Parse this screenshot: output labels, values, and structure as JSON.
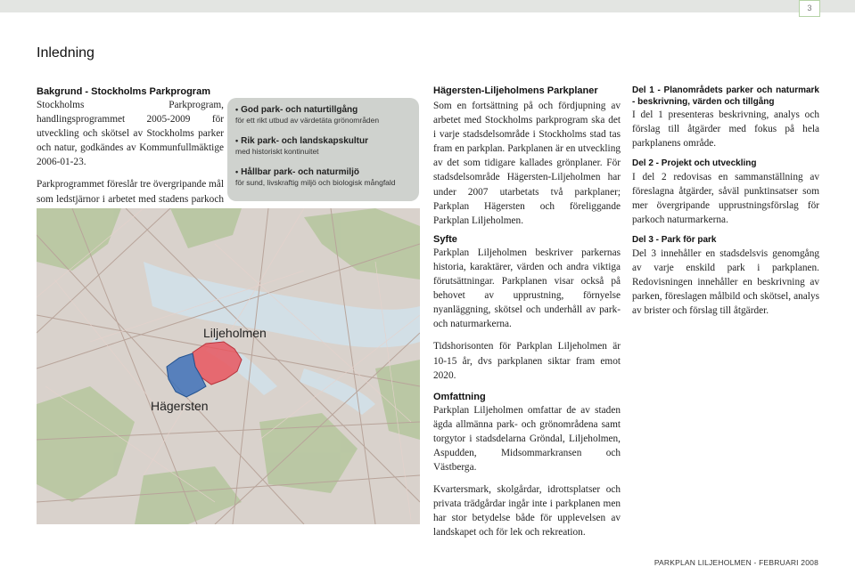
{
  "page_number": "3",
  "title": "Inledning",
  "col1": {
    "heading": "Bakgrund - Stockholms Parkprogram",
    "para1": "Stockholms Parkprogram, handlingsprogrammet 2005-2009 för utveckling och skötsel av Stockholms parker och natur, godkändes av Kommunfullmäktige 2006-01-23.",
    "para2": "Parkprogrammet föreslår tre övergripande mål som ledstjärnor i arbetet med stadens parkoch naturmark:"
  },
  "callout": {
    "items": [
      {
        "head": "God park- och naturtillgång",
        "sub1": "för ett rikt utbud av värdetäta grönområden",
        "sub2": ""
      },
      {
        "head": "Rik park- och landskapskultur",
        "sub1": "med historiskt kontinuitet",
        "sub2": ""
      },
      {
        "head": "Hållbar park- och naturmiljö",
        "sub1": "för sund, livskraftig miljö och biologisk mångfald",
        "sub2": ""
      }
    ]
  },
  "map": {
    "label_liljeholmen": "Liljeholmen",
    "label_hagersten": "Hägersten",
    "colors": {
      "liljeholmen": "#e8575f",
      "hagersten": "#3f72b8",
      "base": "#d7a8a8"
    }
  },
  "col2": {
    "heading": "Hägersten-Liljeholmens Parkplaner",
    "para1": "Som en fortsättning på och fördjupning av arbetet med Stockholms parkprogram ska det i varje stadsdelsområde i Stockholms stad tas fram en parkplan. Parkplanen är en utveckling av det som tidigare kallades grönplaner. För stadsdelsområde Hägersten-Liljeholmen har under 2007 utarbetats två parkplaner; Parkplan Hägersten och föreliggande Parkplan Liljeholmen.",
    "heading2": "Syfte",
    "para2": "Parkplan Liljeholmen beskriver parkernas historia, karaktärer, värden och andra viktiga förutsättningar. Parkplanen visar också på behovet av upprustning, förnyelse nyanläggning, skötsel och underhåll av park- och naturmarkerna.",
    "para3": "Tidshorisonten för Parkplan Liljeholmen är 10-15 år, dvs parkplanen siktar fram emot 2020.",
    "heading3": "Omfattning",
    "para4": "Parkplan Liljeholmen omfattar de av staden ägda allmänna park- och grönområdena samt torgytor i stadsdelarna Gröndal, Liljeholmen, Aspudden, Midsommarkransen och Västberga.",
    "para5": "Kvartersmark, skolgårdar, idrottsplatser och privata trädgårdar ingår inte i parkplanen men har stor betydelse både för upplevelsen av landskapet och för lek och rekreation."
  },
  "col3": {
    "heading1": "Del 1 - Planområdets parker och naturmark - beskrivning, värden och tillgång",
    "para1": "I del 1 presenteras beskrivning, analys och förslag till åtgärder med fokus på hela parkplanens område.",
    "heading2": "Del 2 - Projekt och utveckling",
    "para2": "I del 2 redovisas en sammanställning av föreslagna åtgärder, såväl punktinsatser som mer övergripande upprustningsförslag för parkoch naturmarkerna.",
    "heading3": "Del 3 - Park för park",
    "para3": "Del 3 innehåller en stadsdelsvis genomgång av varje enskild park i parkplanen. Redovisningen innehåller en beskrivning av parken, föreslagen målbild och skötsel, analys av brister och förslag till åtgärder."
  },
  "footer": "PARKPLAN LILJEHOLMEN -  FEBRUARI 2008"
}
